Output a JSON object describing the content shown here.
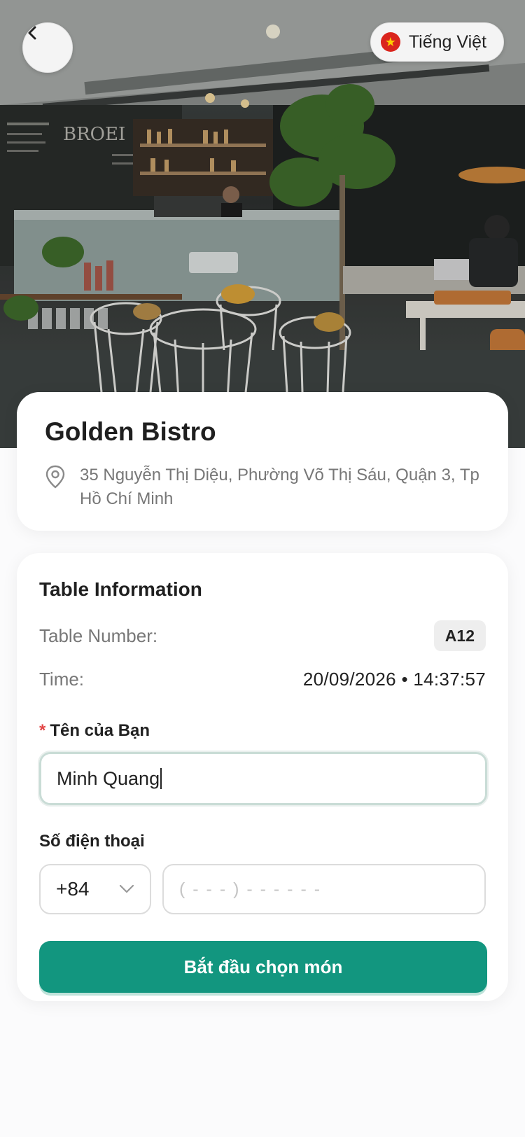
{
  "header": {
    "language_label": "Tiếng Việt",
    "back_icon": "chevron-left-icon",
    "flag_icon": "vietnam-flag-icon"
  },
  "restaurant": {
    "name": "Golden Bistro",
    "address": "35 Nguyễn Thị Diệu, Phường Võ Thị Sáu, Quận 3, Tp Hồ Chí Minh"
  },
  "table_info": {
    "title": "Table Information",
    "table_number_label": "Table Number:",
    "table_number": "A12",
    "time_label": "Time:",
    "time_value": "20/09/2026 • 14:37:57"
  },
  "form": {
    "name_required_mark": "*",
    "name_label": "Tên của Bạn",
    "name_value": "Minh Quang",
    "phone_label": "Số điện thoại",
    "country_code": "+84",
    "phone_placeholder": "( - - - ) - - -  - - -"
  },
  "cta": {
    "label": "Bắt đầu chọn món"
  },
  "colors": {
    "primary": "#12967f",
    "required": "#e24444"
  }
}
